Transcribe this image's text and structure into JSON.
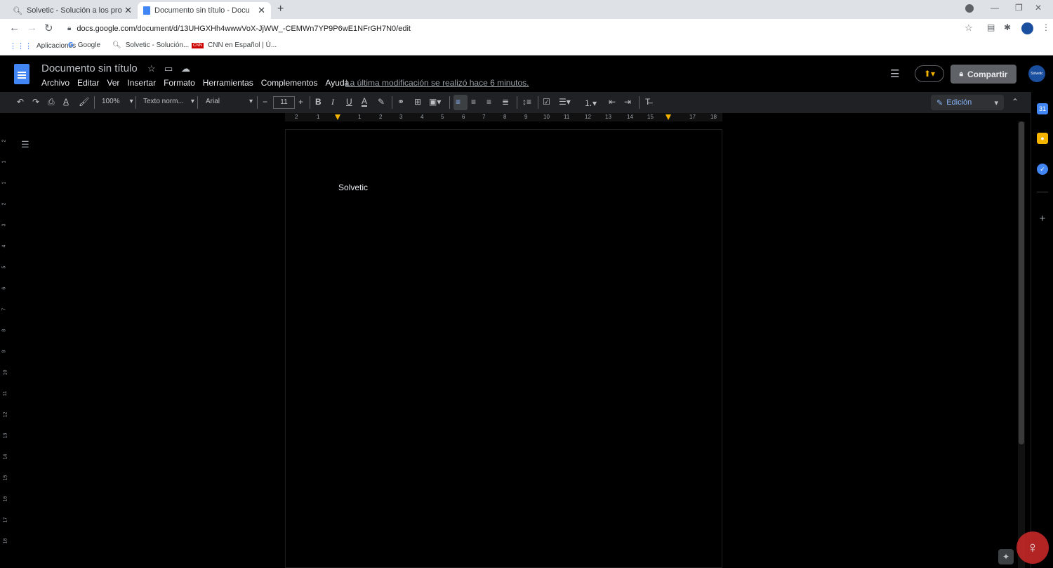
{
  "browser": {
    "tabs": [
      {
        "title": "Solvetic - Solución a los problem",
        "active": false
      },
      {
        "title": "Documento sin título - Documen",
        "active": true
      }
    ],
    "new_tab_label": "+",
    "url": "docs.google.com/document/d/13UHGXHh4wwwVoX-JjWW_-CEMWn7YP9P6wE1NFrGH7N0/edit",
    "bookmarks": [
      {
        "label": "Aplicaciones",
        "icon": "apps-grid-icon"
      },
      {
        "label": "Google",
        "icon": "google-g-icon"
      },
      {
        "label": "Solvetic - Solución...",
        "icon": "solvetic-icon"
      },
      {
        "label": "CNN en Español | Ú...",
        "icon": "cnn-icon"
      }
    ]
  },
  "docs": {
    "title": "Documento sin título",
    "menu": [
      "Archivo",
      "Editar",
      "Ver",
      "Insertar",
      "Formato",
      "Herramientas",
      "Complementos",
      "Ayuda"
    ],
    "last_modified": "La última modificación se realizó hace 6 minutos.",
    "share_label": "Compartir",
    "avatar_label": "Solvetic",
    "toolbar": {
      "zoom": "100%",
      "style": "Texto norm...",
      "font": "Arial",
      "font_size": "11",
      "mode": "Edición"
    },
    "ruler_numbers": [
      "2",
      "1",
      "1",
      "2",
      "3",
      "4",
      "5",
      "6",
      "7",
      "8",
      "9",
      "10",
      "11",
      "12",
      "13",
      "14",
      "15",
      "17",
      "18"
    ],
    "vruler_numbers": [
      "2",
      "1",
      "1",
      "2",
      "3",
      "4",
      "5",
      "6",
      "7",
      "8",
      "9",
      "10",
      "11",
      "12",
      "13",
      "14",
      "15",
      "16",
      "17",
      "18"
    ],
    "body_text": "Solvetic"
  },
  "colors": {
    "accent_blue": "#4285f4",
    "present_yellow": "#f4b400",
    "share_gray": "#5f6368",
    "mode_blue": "#8ab4f8"
  }
}
